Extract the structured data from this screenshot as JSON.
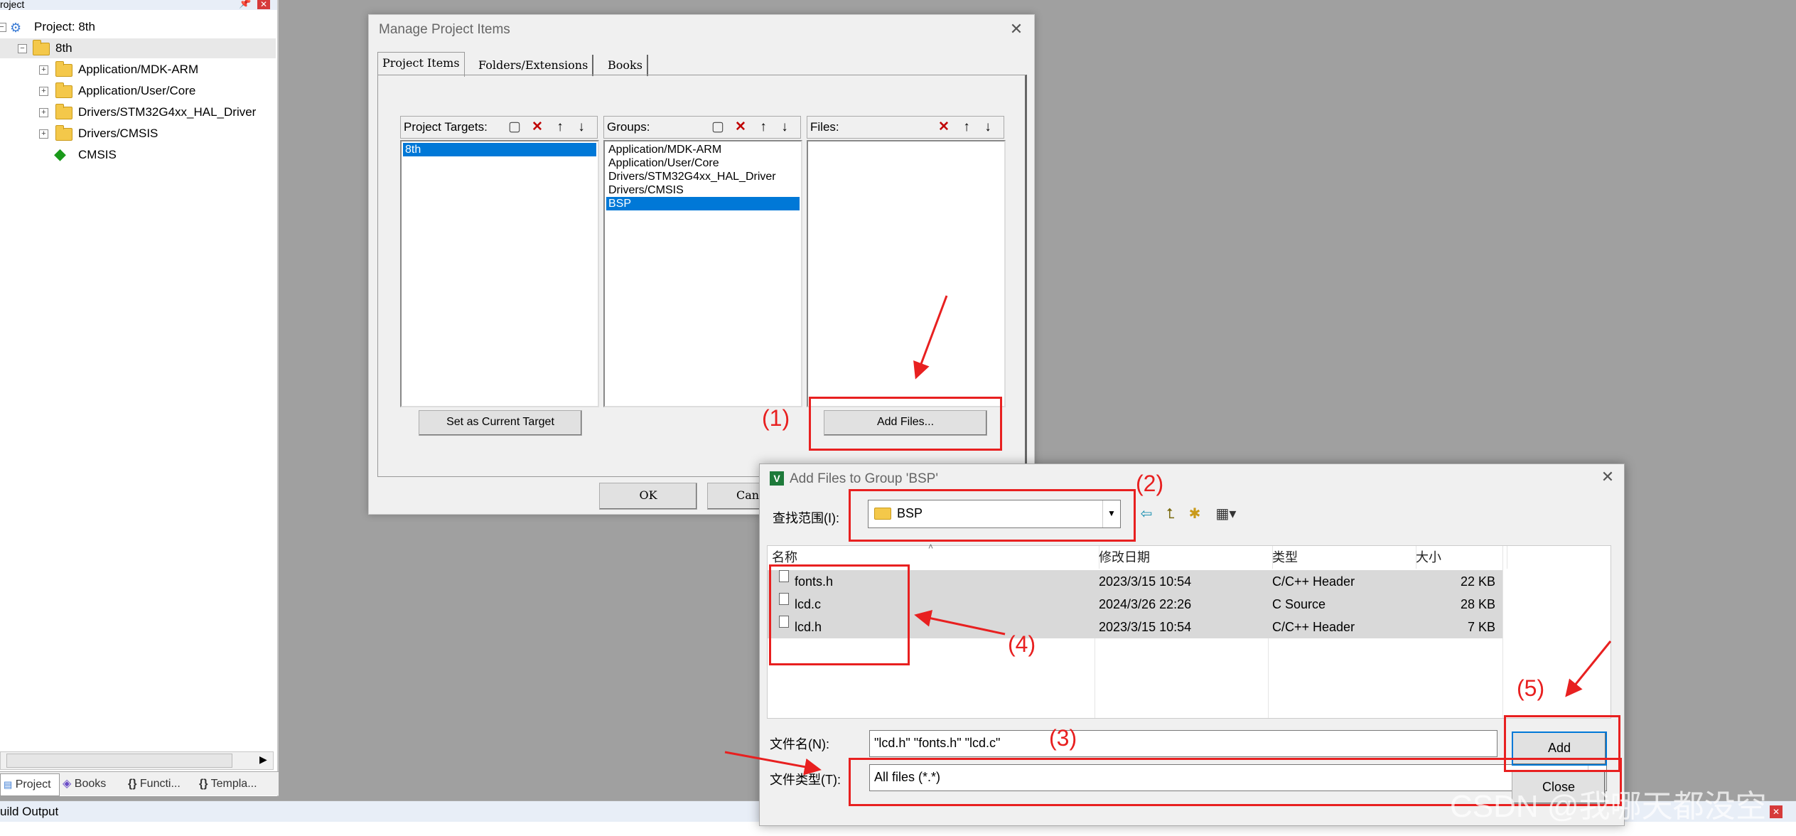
{
  "project_panel": {
    "title": "roject",
    "pin_icon": "pin-icon",
    "close_icon": "close-icon",
    "tree": [
      {
        "label": "Project: 8th",
        "icon": "project-icon"
      },
      {
        "label": "8th",
        "icon": "target-folder-icon"
      },
      {
        "label": "Application/MDK-ARM",
        "icon": "folder-icon"
      },
      {
        "label": "Application/User/Core",
        "icon": "folder-icon"
      },
      {
        "label": "Drivers/STM32G4xx_HAL_Driver",
        "icon": "folder-icon"
      },
      {
        "label": "Drivers/CMSIS",
        "icon": "folder-icon"
      },
      {
        "label": "CMSIS",
        "icon": "cmsis-diamond-icon"
      }
    ],
    "tabs": [
      "Project",
      "Books",
      "Functi...",
      "Templa..."
    ]
  },
  "build_output": {
    "title": "uild Output"
  },
  "manage_dialog": {
    "title": "Manage Project Items",
    "tabs": [
      "Project Items",
      "Folders/Extensions",
      "Books"
    ],
    "targets_label": "Project Targets:",
    "targets": [
      "8th"
    ],
    "groups_label": "Groups:",
    "groups": [
      "Application/MDK-ARM",
      "Application/User/Core",
      "Drivers/STM32G4xx_HAL_Driver",
      "Drivers/CMSIS",
      "BSP"
    ],
    "files_label": "Files:",
    "set_current_label": "Set as Current Target",
    "add_files_label": "Add Files...",
    "ok_label": "OK",
    "cancel_label": "Canc"
  },
  "add_files_dialog": {
    "title": "Add Files to Group 'BSP'",
    "look_in_label": "查找范围(I):",
    "look_in_value": "BSP",
    "columns": [
      "名称",
      "修改日期",
      "类型",
      "大小"
    ],
    "files": [
      {
        "name": "fonts.h",
        "modified": "2023/3/15 10:54",
        "type": "C/C++ Header",
        "size": "22 KB"
      },
      {
        "name": "lcd.c",
        "modified": "2024/3/26 22:26",
        "type": "C Source",
        "size": "28 KB"
      },
      {
        "name": "lcd.h",
        "modified": "2023/3/15 10:54",
        "type": "C/C++ Header",
        "size": "7 KB"
      }
    ],
    "filename_label": "文件名(N):",
    "filename_value": "\"lcd.h\" \"fonts.h\" \"lcd.c\"",
    "filetype_label": "文件类型(T):",
    "filetype_value": "All files (*.*)",
    "add_label": "Add",
    "close_label": "Close"
  },
  "annotations": [
    "(1)",
    "(2)",
    "(3)",
    "(4)",
    "(5)"
  ],
  "watermark": "CSDN @我哪天都没空",
  "colors": {
    "selection": "#0078d7",
    "annotation": "#e82020",
    "background": "#a0a0a0"
  }
}
